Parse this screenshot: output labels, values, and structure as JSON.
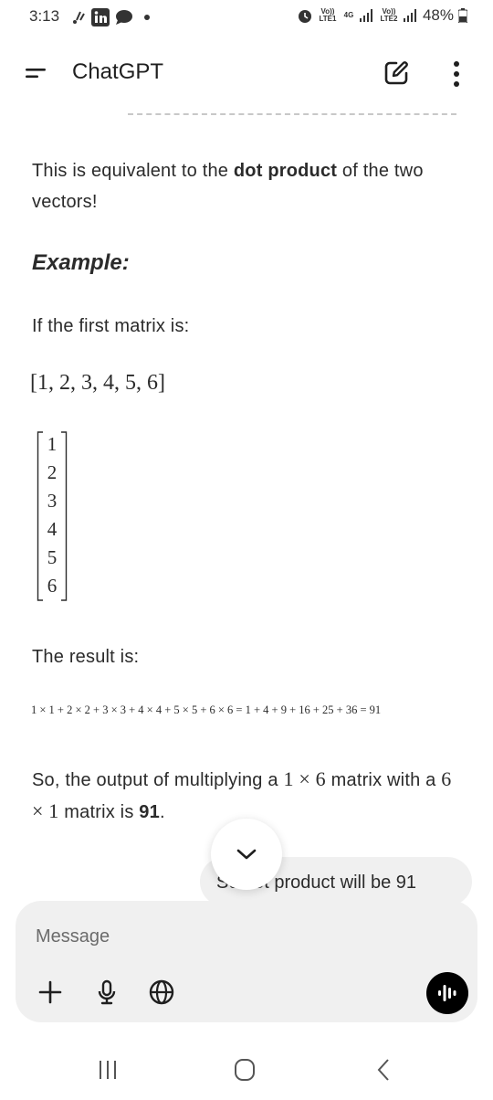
{
  "status_bar": {
    "time": "3:13",
    "lte1": "Vo)) LTE1",
    "network": "4G",
    "lte2": "Vo)) LTE2",
    "battery": "48%"
  },
  "app_bar": {
    "title": "ChatGPT"
  },
  "response": {
    "para1_prefix": "This is equivalent to the ",
    "para1_bold": "dot product",
    "para1_suffix": " of the two vectors!",
    "example_heading": "Example:",
    "first_matrix_text": "If the first matrix is:",
    "row_vector": "[1, 2, 3, 4, 5, 6]",
    "column_vector": [
      "1",
      "2",
      "3",
      "4",
      "5",
      "6"
    ],
    "result_text": "The result is:",
    "equation": "1 × 1 + 2 × 2 + 3 × 3 + 4 × 4 + 5 × 5 + 6 × 6 = 1 + 4 + 9 + 16 + 25 + 36 = 91",
    "conclusion_prefix": "So, the output of multiplying a ",
    "conclusion_math1": "1 × 6",
    "conclusion_mid": " matrix with a ",
    "conclusion_math2": "6 × 1",
    "conclusion_mid2": " matrix is ",
    "conclusion_bold": "91",
    "conclusion_end": "."
  },
  "user_message": {
    "text": "So dot product will be 91"
  },
  "composer": {
    "placeholder": "Message"
  },
  "icons": {
    "left_status": [
      "sms-icon",
      "linkedin-icon",
      "chat-icon",
      "dot-icon"
    ],
    "right_status": [
      "alarm-icon",
      "signal-icon",
      "battery-icon"
    ],
    "app_bar": [
      "menu-icon",
      "new-chat-icon",
      "more-icon"
    ],
    "composer": [
      "plus-icon",
      "microphone-icon",
      "globe-icon",
      "voice-mode-icon"
    ],
    "nav": [
      "recent-apps-icon",
      "home-icon",
      "back-icon"
    ]
  }
}
